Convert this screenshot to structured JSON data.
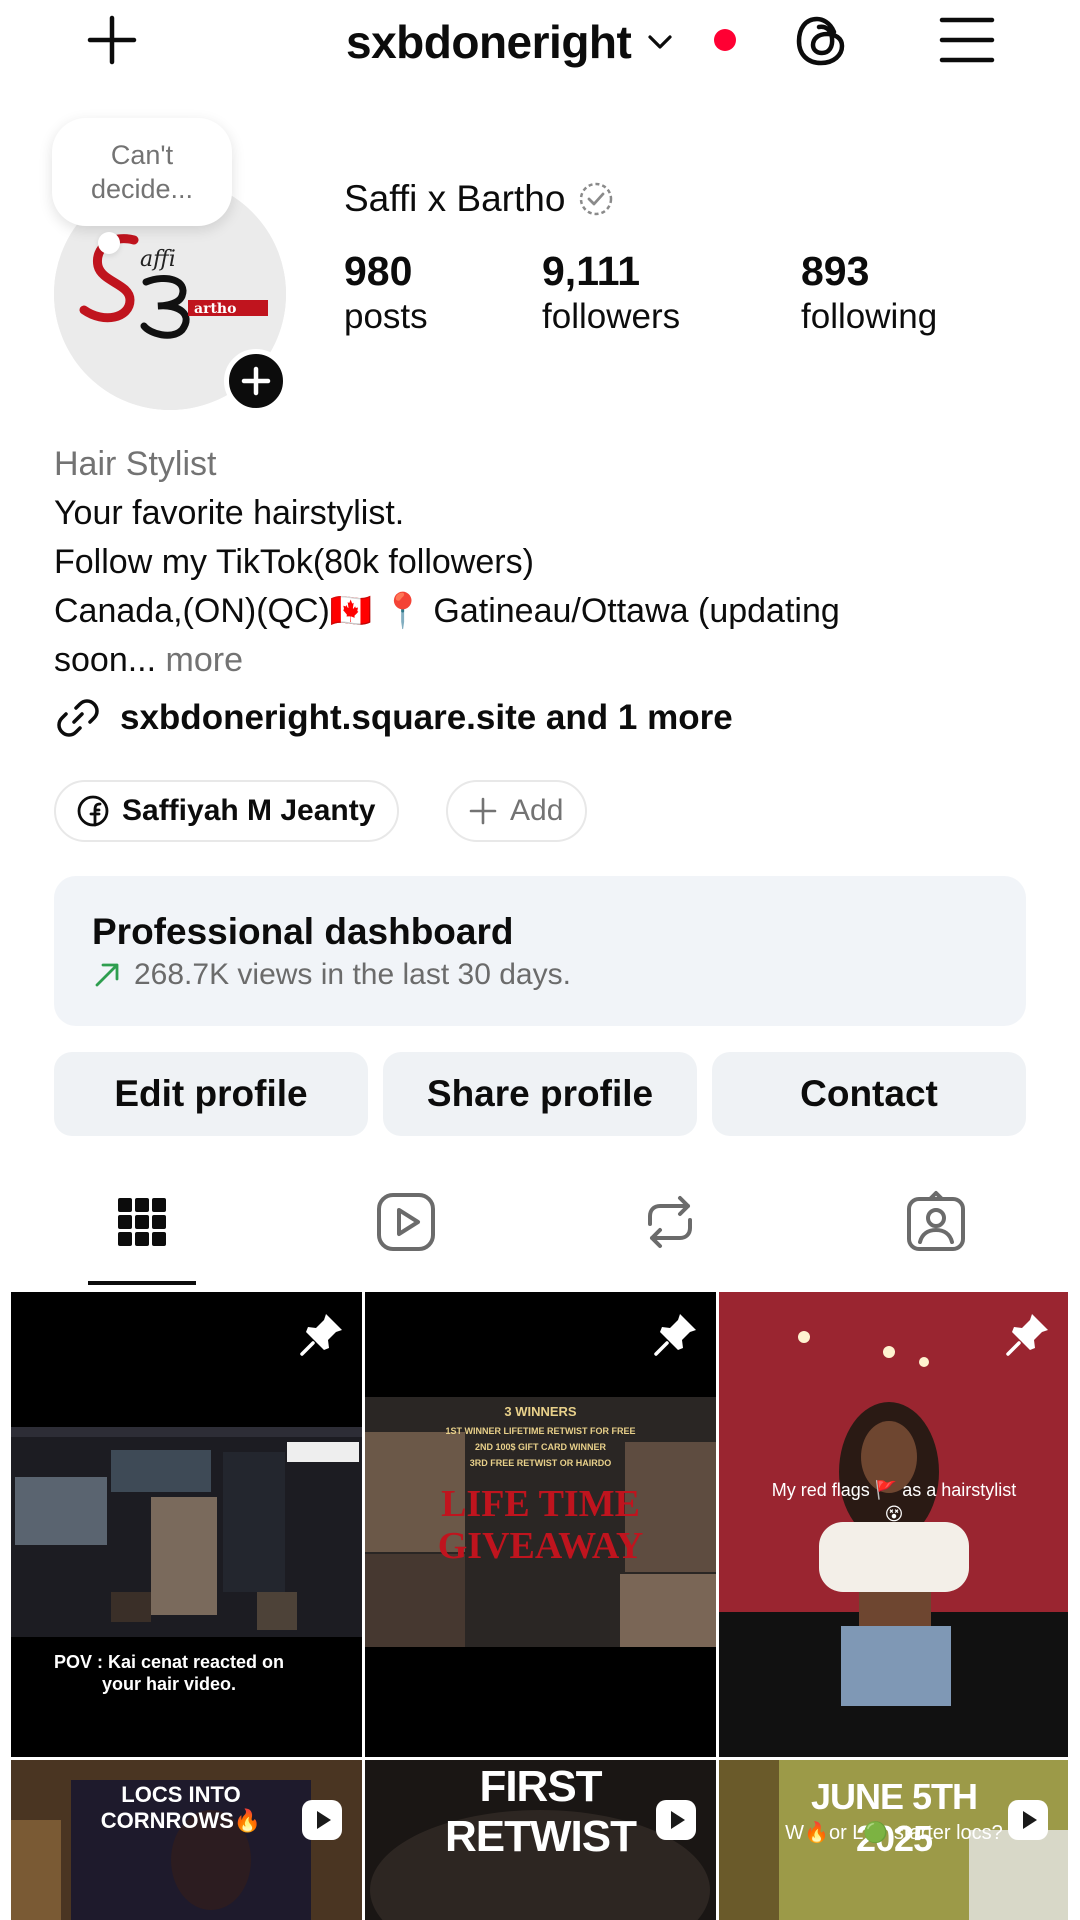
{
  "header": {
    "username": "sxbdoneright"
  },
  "profile": {
    "note": "Can't decide...",
    "display_name": "Saffi x Bartho",
    "stats": [
      {
        "value": "980",
        "label": "posts"
      },
      {
        "value": "9,111",
        "label": "followers"
      },
      {
        "value": "893",
        "label": "following"
      }
    ],
    "category": "Hair Stylist",
    "bio_line1": "Your favorite hairstylist.",
    "bio_line2": "Follow my TikTok(80k followers)",
    "bio_line3": "Canada,(ON)(QC)🇨🇦 📍 Gatineau/Ottawa (updating",
    "bio_line4": "soon...",
    "bio_more": "more",
    "link": "sxbdoneright.square.site and 1 more"
  },
  "chips": {
    "facebook_label": "Saffiyah M Jeanty",
    "add_label": "Add"
  },
  "dashboard": {
    "title": "Professional dashboard",
    "subtitle": "268.7K views in the last 30 days."
  },
  "actions": {
    "edit": "Edit profile",
    "share": "Share profile",
    "contact": "Contact"
  },
  "tabs": [
    "grid-icon",
    "reels-icon",
    "reposts-icon",
    "tagged-icon"
  ],
  "posts": {
    "post1_caption": "POV : Kai cenat reacted on your hair video.",
    "post2_header": "3 WINNERS",
    "post2_line1": "1ST WINNER LIFETIME RETWIST FOR FREE",
    "post2_line2": "2ND 100$ GIFT CARD WINNER",
    "post2_line3": "3RD FREE RETWIST OR HAIRDO",
    "post2_title1": "LIFE TIME",
    "post2_title2": "GIVEAWAY",
    "post3_caption": "My red flags 🚩 as a hairstylist😵",
    "post4_caption": "LOCS INTO CORNROWS🔥",
    "post5_caption": "FIRST RETWIST",
    "post6_caption1": "JUNE 5TH 2025",
    "post6_caption2": "W🔥or L🟢 starter locs?"
  },
  "colors": {
    "accent_red": "#ff0033",
    "dashboard_bg": "#f1f4f8",
    "button_bg": "#eff2f5",
    "muted_text": "#737373"
  }
}
